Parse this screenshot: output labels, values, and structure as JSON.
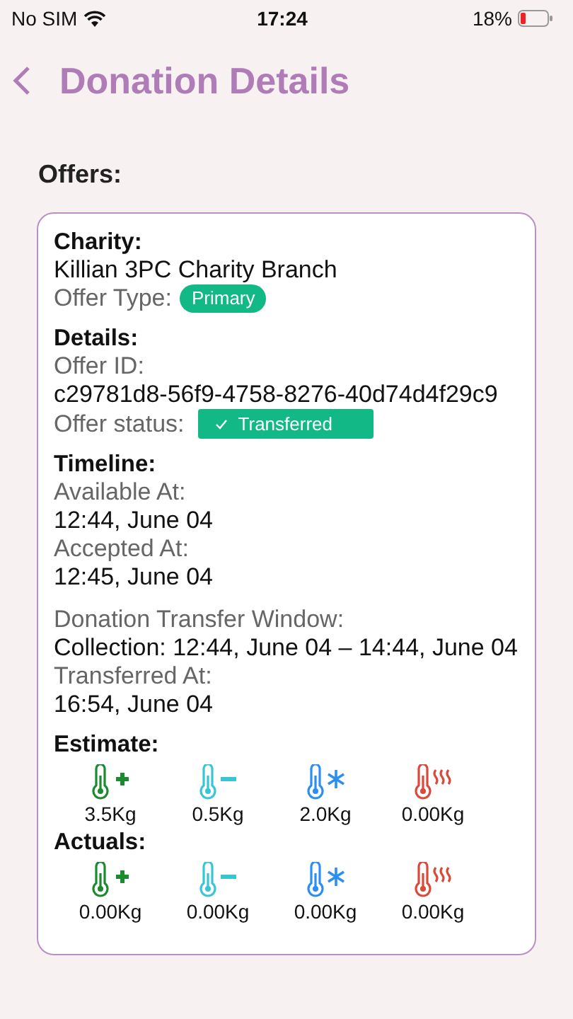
{
  "status_bar": {
    "carrier": "No SIM",
    "time": "17:24",
    "battery": "18%"
  },
  "header": {
    "title": "Donation Details"
  },
  "section_title": "Offers:",
  "offer": {
    "charity_heading": "Charity:",
    "charity_name": "Killian 3PC Charity Branch",
    "offer_type_label": "Offer Type:",
    "offer_type": "Primary",
    "details_heading": "Details:",
    "offer_id_label": "Offer ID:",
    "offer_id": "c29781d8-56f9-4758-8276-40d74d4f29c9",
    "status_label": "Offer status:",
    "status": "Transferred",
    "timeline_heading": "Timeline:",
    "timeline": [
      {
        "entries": [
          {
            "label": "Available At:",
            "value": "12:44, June 04"
          },
          {
            "label": "Accepted At:",
            "value": "12:45, June 04"
          }
        ]
      },
      {
        "entries": [
          {
            "label": "Donation Transfer Window:",
            "value": "Collection: 12:44, June 04 – 14:44, June 04"
          },
          {
            "label": "Transferred At:",
            "value": "16:54, June 04"
          }
        ]
      }
    ],
    "estimate_heading": "Estimate:",
    "estimate": [
      {
        "kind": "ambient",
        "weight": "3.5Kg"
      },
      {
        "kind": "chilled",
        "weight": "0.5Kg"
      },
      {
        "kind": "frozen",
        "weight": "2.0Kg"
      },
      {
        "kind": "hot",
        "weight": "0.00Kg"
      }
    ],
    "actuals_heading": "Actuals:",
    "actuals": [
      {
        "kind": "ambient",
        "weight": "0.00Kg"
      },
      {
        "kind": "chilled",
        "weight": "0.00Kg"
      },
      {
        "kind": "frozen",
        "weight": "0.00Kg"
      },
      {
        "kind": "hot",
        "weight": "0.00Kg"
      }
    ]
  }
}
